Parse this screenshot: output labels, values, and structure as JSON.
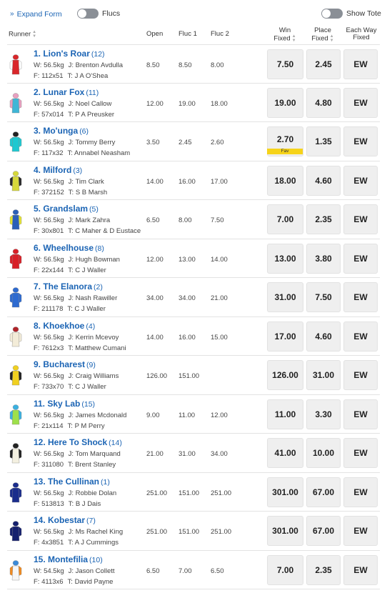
{
  "controls": {
    "expand_form": "Expand Form",
    "flucs": "Flucs",
    "show_tote": "Show Tote"
  },
  "headers": {
    "runner": "Runner",
    "open": "Open",
    "fluc1": "Fluc 1",
    "fluc2": "Fluc 2",
    "win_1": "Win",
    "win_2": "Fixed",
    "place_1": "Place",
    "place_2": "Fixed",
    "ew_1": "Each Way",
    "ew_2": "Fixed"
  },
  "runners": [
    {
      "name": "1. Lion's Roar",
      "barrier": "(12)",
      "weight": "W: 56.5kg",
      "jockey": "J: Brenton Avdulla",
      "form": "F: 112x51",
      "trainer": "T: J A O'Shea",
      "open": "8.50",
      "fluc1": "8.50",
      "fluc2": "8.00",
      "win": "7.50",
      "place": "2.45",
      "ew": "EW",
      "silk": {
        "body": "#d9262a",
        "sleeve": "#ffffff",
        "cap": "#d9262a"
      }
    },
    {
      "name": "2. Lunar Fox",
      "barrier": "(11)",
      "weight": "W: 56.5kg",
      "jockey": "J: Noel Callow",
      "form": "F: 57x014",
      "trainer": "T: P A Preusker",
      "open": "12.00",
      "fluc1": "19.00",
      "fluc2": "18.00",
      "win": "19.00",
      "place": "4.80",
      "ew": "EW",
      "silk": {
        "body": "#3fb6d6",
        "sleeve": "#e8a0c0",
        "cap": "#e8a0c0"
      }
    },
    {
      "name": "3. Mo'unga",
      "barrier": "(6)",
      "weight": "W: 56.5kg",
      "jockey": "J: Tommy Berry",
      "form": "F: 117x32",
      "trainer": "T: Annabel Neasham",
      "open": "3.50",
      "fluc1": "2.45",
      "fluc2": "2.60",
      "win": "2.70",
      "place": "1.35",
      "ew": "EW",
      "fav": "Fav",
      "silk": {
        "body": "#1ec8d0",
        "sleeve": "#1ec8d0",
        "cap": "#222222"
      }
    },
    {
      "name": "4. Milford",
      "barrier": "(3)",
      "weight": "W: 56.5kg",
      "jockey": "J: Tim Clark",
      "form": "F: 372152",
      "trainer": "T: S B Marsh",
      "open": "14.00",
      "fluc1": "16.00",
      "fluc2": "17.00",
      "win": "18.00",
      "place": "4.60",
      "ew": "EW",
      "silk": {
        "body": "#d6d83a",
        "sleeve": "#2a2a2a",
        "cap": "#d6d83a"
      }
    },
    {
      "name": "5. Grandslam",
      "barrier": "(5)",
      "weight": "W: 56.5kg",
      "jockey": "J: Mark Zahra",
      "form": "F: 30x801",
      "trainer": "T: C Maher & D Eustace",
      "open": "6.50",
      "fluc1": "8.00",
      "fluc2": "7.50",
      "win": "7.00",
      "place": "2.35",
      "ew": "EW",
      "silk": {
        "body": "#2b5fb8",
        "sleeve": "#e3e233",
        "cap": "#2b5fb8"
      }
    },
    {
      "name": "6. Wheelhouse",
      "barrier": "(8)",
      "weight": "W: 56.5kg",
      "jockey": "J: Hugh Bowman",
      "form": "F: 22x144",
      "trainer": "T: C J Waller",
      "open": "12.00",
      "fluc1": "13.00",
      "fluc2": "14.00",
      "win": "13.00",
      "place": "3.80",
      "ew": "EW",
      "silk": {
        "body": "#d82028",
        "sleeve": "#d82028",
        "cap": "#d82028"
      }
    },
    {
      "name": "7. The Elanora",
      "barrier": "(2)",
      "weight": "W: 56.5kg",
      "jockey": "J: Nash Rawiller",
      "form": "F: 211178",
      "trainer": "T: C J Waller",
      "open": "34.00",
      "fluc1": "34.00",
      "fluc2": "21.00",
      "win": "31.00",
      "place": "7.50",
      "ew": "EW",
      "silk": {
        "body": "#2d6ad0",
        "sleeve": "#2d6ad0",
        "cap": "#2d6ad0"
      }
    },
    {
      "name": "8. Khoekhoe",
      "barrier": "(4)",
      "weight": "W: 56.5kg",
      "jockey": "J: Kerrin Mcevoy",
      "form": "F: 7612x3",
      "trainer": "T: Matthew Cumani",
      "open": "14.00",
      "fluc1": "16.00",
      "fluc2": "15.00",
      "win": "17.00",
      "place": "4.60",
      "ew": "EW",
      "silk": {
        "body": "#f3ecd8",
        "sleeve": "#f3ecd8",
        "cap": "#b0242a"
      }
    },
    {
      "name": "9. Bucharest",
      "barrier": "(9)",
      "weight": "W: 56.5kg",
      "jockey": "J: Craig Williams",
      "form": "F: 733x70",
      "trainer": "T: C J Waller",
      "open": "126.00",
      "fluc1": "151.00",
      "fluc2": "",
      "win": "126.00",
      "place": "31.00",
      "ew": "EW",
      "silk": {
        "body": "#f0d020",
        "sleeve": "#222222",
        "cap": "#f0d020"
      }
    },
    {
      "name": "11. Sky Lab",
      "barrier": "(15)",
      "weight": "W: 56.5kg",
      "jockey": "J: James Mcdonald",
      "form": "F: 21x114",
      "trainer": "T: P M Perry",
      "open": "9.00",
      "fluc1": "11.00",
      "fluc2": "12.00",
      "win": "11.00",
      "place": "3.30",
      "ew": "EW",
      "silk": {
        "body": "#9ee04a",
        "sleeve": "#3bb0e0",
        "cap": "#3bb0e0"
      }
    },
    {
      "name": "12. Here To Shock",
      "barrier": "(14)",
      "weight": "W: 56.5kg",
      "jockey": "J: Tom Marquand",
      "form": "F: 311080",
      "trainer": "T: Brent Stanley",
      "open": "21.00",
      "fluc1": "31.00",
      "fluc2": "34.00",
      "win": "41.00",
      "place": "10.00",
      "ew": "EW",
      "silk": {
        "body": "#f4f0e0",
        "sleeve": "#222222",
        "cap": "#222222"
      }
    },
    {
      "name": "13. The Cullinan",
      "barrier": "(1)",
      "weight": "W: 56.5kg",
      "jockey": "J: Robbie Dolan",
      "form": "F: 513813",
      "trainer": "T: B J Dais",
      "open": "251.00",
      "fluc1": "151.00",
      "fluc2": "251.00",
      "win": "301.00",
      "place": "67.00",
      "ew": "EW",
      "silk": {
        "body": "#1a2d8c",
        "sleeve": "#1a2d8c",
        "cap": "#1a2d8c"
      }
    },
    {
      "name": "14. Kobestar",
      "barrier": "(7)",
      "weight": "W: 56.5kg",
      "jockey": "J: Ms Rachel King",
      "form": "F: 4x3851",
      "trainer": "T: A J Cummings",
      "open": "251.00",
      "fluc1": "151.00",
      "fluc2": "251.00",
      "win": "301.00",
      "place": "67.00",
      "ew": "EW",
      "silk": {
        "body": "#15206e",
        "sleeve": "#15206e",
        "cap": "#15206e"
      }
    },
    {
      "name": "15. Montefilia",
      "barrier": "(10)",
      "weight": "W: 54.5kg",
      "jockey": "J: Jason Collett",
      "form": "F: 4113x6",
      "trainer": "T: David Payne",
      "open": "6.50",
      "fluc1": "7.00",
      "fluc2": "6.50",
      "win": "7.00",
      "place": "2.35",
      "ew": "EW",
      "silk": {
        "body": "#f6f6f6",
        "sleeve": "#f08a20",
        "cap": "#3b8ad8"
      }
    }
  ]
}
